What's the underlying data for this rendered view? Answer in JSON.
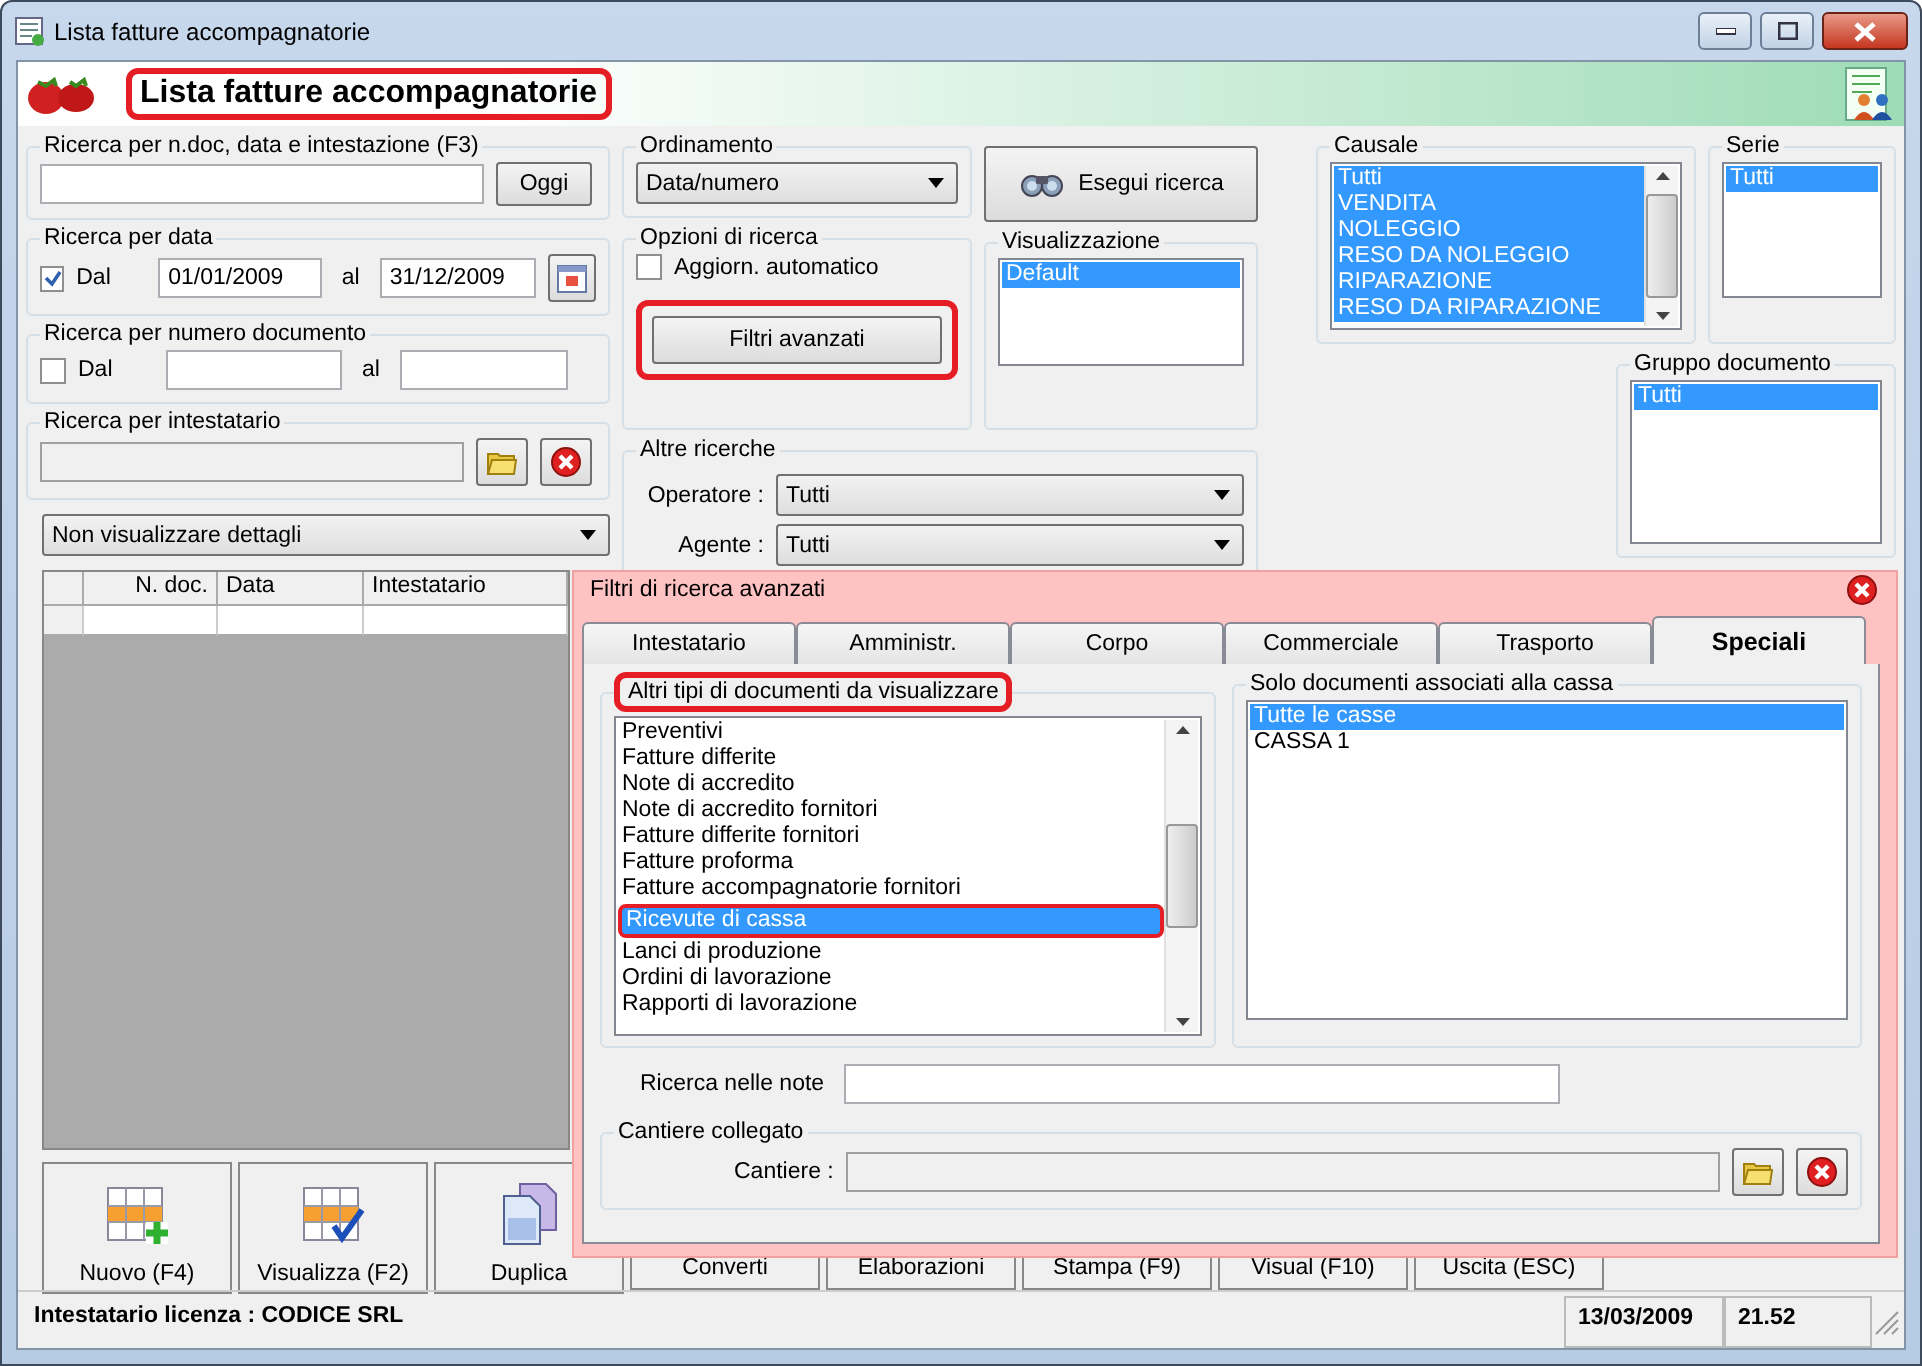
{
  "window": {
    "title": "Lista fatture accompagnatorie"
  },
  "header": {
    "title": "Lista fatture accompagnatorie",
    "highlighted": true
  },
  "quick_search": {
    "label": "Ricerca per n.doc, data e intestazione (F3)",
    "button": "Oggi"
  },
  "date_search": {
    "label": "Ricerca per data",
    "checkbox": {
      "label": "Dal",
      "checked": true
    },
    "from": "01/01/2009",
    "to_label": "al",
    "to": "31/12/2009"
  },
  "number_search": {
    "label": "Ricerca per numero documento",
    "checkbox": {
      "label": "Dal",
      "checked": false
    },
    "to_label": "al"
  },
  "holder_search": {
    "label": "Ricerca per intestatario"
  },
  "details_select": {
    "value": "Non visualizzare dettagli"
  },
  "table": {
    "columns": [
      "N. doc.",
      "Data",
      "Intestatario"
    ]
  },
  "sort": {
    "label": "Ordinamento",
    "value": "Data/numero"
  },
  "search_button": {
    "label": "Esegui ricerca"
  },
  "options": {
    "label": "Opzioni di ricerca",
    "auto_update": {
      "label": "Aggiorn. automatico",
      "checked": false
    },
    "advanced_button": {
      "label": "Filtri avanzati",
      "highlighted": true
    }
  },
  "view": {
    "label": "Visualizzazione",
    "items": [
      {
        "label": "Default",
        "selected": true
      }
    ]
  },
  "other": {
    "label": "Altre ricerche",
    "fields": [
      {
        "label": "Operatore :",
        "value": "Tutti"
      },
      {
        "label": "Agente :",
        "value": "Tutti"
      }
    ]
  },
  "causale": {
    "label": "Causale",
    "items": [
      {
        "label": "Tutti",
        "selected": true
      },
      {
        "label": "VENDITA",
        "selected": true
      },
      {
        "label": "NOLEGGIO",
        "selected": true
      },
      {
        "label": "RESO DA NOLEGGIO",
        "selected": true
      },
      {
        "label": "RIPARAZIONE",
        "selected": true
      },
      {
        "label": "RESO DA RIPARAZIONE",
        "selected": true
      }
    ]
  },
  "serie": {
    "label": "Serie",
    "items": [
      {
        "label": "Tutti",
        "selected": true
      }
    ]
  },
  "group": {
    "label": "Gruppo documento",
    "items": [
      {
        "label": "Tutti",
        "selected": true
      }
    ]
  },
  "toolbar": [
    {
      "label": "Nuovo (F4)",
      "kind": "new"
    },
    {
      "label": "Visualizza (F2)",
      "kind": "view"
    },
    {
      "label": "Duplica",
      "kind": "copy"
    },
    {
      "label": "Converti",
      "kind": "plain"
    },
    {
      "label": "Elaborazioni",
      "kind": "plain"
    },
    {
      "label": "Stampa (F9)",
      "kind": "plain"
    },
    {
      "label": "Visual (F10)",
      "kind": "plain"
    },
    {
      "label": "Uscita (ESC)",
      "kind": "plain"
    }
  ],
  "advanced": {
    "title": "Filtri di ricerca avanzati",
    "tabs": [
      {
        "label": "Intestatario",
        "selected": false
      },
      {
        "label": "Amministr.",
        "selected": false
      },
      {
        "label": "Corpo",
        "selected": false
      },
      {
        "label": "Commerciale",
        "selected": false
      },
      {
        "label": "Trasporto",
        "selected": false
      },
      {
        "label": "Speciali",
        "selected": true
      }
    ],
    "doc_types": {
      "label": "Altri tipi di documenti da visualizzare",
      "highlighted": true,
      "items": [
        {
          "label": "Preventivi",
          "selected": false,
          "highlighted": false
        },
        {
          "label": "Fatture differite",
          "selected": false,
          "highlighted": false
        },
        {
          "label": "Note di accredito",
          "selected": false,
          "highlighted": false
        },
        {
          "label": "Note di accredito fornitori",
          "selected": false,
          "highlighted": false
        },
        {
          "label": "Fatture differite fornitori",
          "selected": false,
          "highlighted": false
        },
        {
          "label": "Fatture proforma",
          "selected": false,
          "highlighted": false
        },
        {
          "label": "Fatture accompagnatorie fornitori",
          "selected": false,
          "highlighted": false
        },
        {
          "label": "Ricevute di cassa",
          "selected": true,
          "highlighted": true
        },
        {
          "label": "Lanci di produzione",
          "selected": false,
          "highlighted": false
        },
        {
          "label": "Ordini di lavorazione",
          "selected": false,
          "highlighted": false
        },
        {
          "label": "Rapporti di lavorazione",
          "selected": false,
          "highlighted": false
        }
      ]
    },
    "cash": {
      "label": "Solo documenti associati alla cassa",
      "items": [
        {
          "label": "Tutte le casse",
          "selected": true
        },
        {
          "label": "CASSA 1",
          "selected": false
        }
      ]
    },
    "notes_label": "Ricerca nelle note",
    "site": {
      "label": "Cantiere collegato",
      "field_label": "Cantiere :"
    }
  },
  "status_bar": {
    "license": "Intestatario licenza : CODICE SRL",
    "date": "13/03/2009",
    "time": "21.52"
  }
}
